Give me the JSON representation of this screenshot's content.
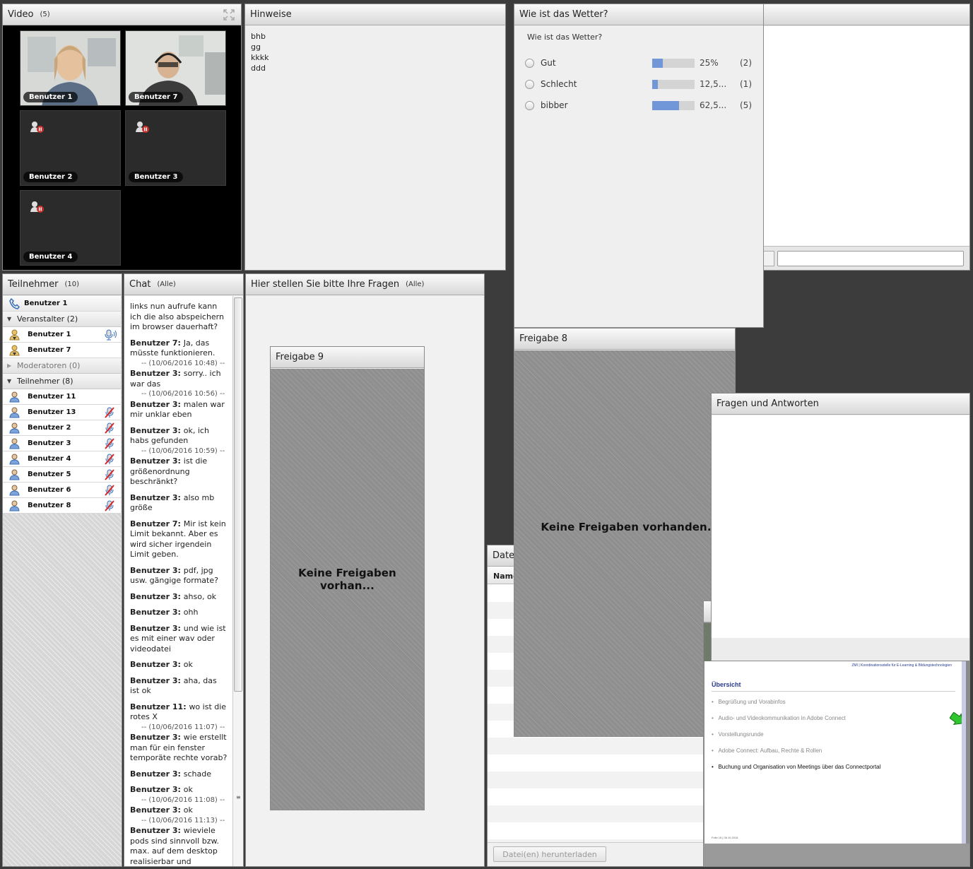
{
  "video": {
    "title": "Video",
    "count": "(5)",
    "tiles": [
      {
        "label": "Benutzer 1"
      },
      {
        "label": "Benutzer 7"
      },
      {
        "label": "Benutzer 2"
      },
      {
        "label": "Benutzer 3"
      },
      {
        "label": "Benutzer 4"
      }
    ]
  },
  "notes": {
    "title": "Hinweise",
    "lines": [
      "bhb",
      "gg",
      "kkkk",
      "ddd"
    ]
  },
  "poll": {
    "title": "Wie ist das Wetter?",
    "question": "Wie ist das Wetter?",
    "options": [
      {
        "label": "Gut",
        "percent_text": "25%",
        "count": "(2)",
        "fraction": 0.25
      },
      {
        "label": "Schlecht",
        "percent_text": "12,5...",
        "count": "(1)",
        "fraction": 0.125
      },
      {
        "label": "bibber",
        "percent_text": "62,5...",
        "count": "(5)",
        "fraction": 0.625
      }
    ]
  },
  "attendees": {
    "title": "Teilnehmer",
    "count": "(10)",
    "self": "Benutzer 1",
    "hosts_group": "Veranstalter (2)",
    "hosts": [
      "Benutzer 1",
      "Benutzer 7"
    ],
    "presenters_group": "Moderatoren (0)",
    "participants_group": "Teilnehmer (8)",
    "participants": [
      "Benutzer 11",
      "Benutzer 13",
      "Benutzer 2",
      "Benutzer 3",
      "Benutzer 4",
      "Benutzer 5",
      "Benutzer 6",
      "Benutzer 8"
    ]
  },
  "chat": {
    "title": "Chat",
    "scope": "(Alle)",
    "messages": [
      {
        "author": "",
        "text": "links nun aufrufe kann ich die also abspeichern im browser dauerhaft?",
        "ts": ""
      },
      {
        "author": "Benutzer 7",
        "text": "Ja, das müsste funktionieren.",
        "ts": "-- (10/06/2016 10:48) --"
      },
      {
        "author": "Benutzer 3",
        "text": "sorry.. ich war das",
        "ts": "-- (10/06/2016 10:56) --"
      },
      {
        "author": "Benutzer 3",
        "text": "malen war mir unklar eben",
        "ts": ""
      },
      {
        "author": "Benutzer 3",
        "text": "ok, ich habs gefunden",
        "ts": "-- (10/06/2016 10:59) --"
      },
      {
        "author": "Benutzer 3",
        "text": "ist die größenordnung beschränkt?",
        "ts": ""
      },
      {
        "author": "Benutzer 3",
        "text": "also mb größe",
        "ts": ""
      },
      {
        "author": "Benutzer 7",
        "text": "Mir ist kein Limit bekannt. Aber es wird sicher irgendein Limit geben.",
        "ts": ""
      },
      {
        "author": "Benutzer 3",
        "text": "pdf, jpg usw. gängige formate?",
        "ts": ""
      },
      {
        "author": "Benutzer 3",
        "text": "ahso, ok",
        "ts": ""
      },
      {
        "author": "Benutzer 3",
        "text": "ohh",
        "ts": ""
      },
      {
        "author": "Benutzer 3",
        "text": "und wie ist es mit einer wav oder videodatei",
        "ts": ""
      },
      {
        "author": "Benutzer 3",
        "text": "ok",
        "ts": ""
      },
      {
        "author": "Benutzer 3",
        "text": "aha, das ist ok",
        "ts": ""
      },
      {
        "author": "Benutzer 11",
        "text": "wo ist die rotes X",
        "ts": "-- (10/06/2016 11:07) --"
      },
      {
        "author": "Benutzer 3",
        "text": "wie erstellt man für ein fenster temporäte rechte vorab?",
        "ts": ""
      },
      {
        "author": "Benutzer 3",
        "text": "schade",
        "ts": ""
      },
      {
        "author": "Benutzer 3",
        "text": "ok",
        "ts": "-- (10/06/2016 11:08) --"
      },
      {
        "author": "Benutzer 3",
        "text": "ok",
        "ts": "-- (10/06/2016 11:13) --"
      },
      {
        "author": "Benutzer 3",
        "text": "wieviele pods sind sinnvoll bzw. max. auf dem desktop realisierbar und erkennbar",
        "ts": ""
      }
    ]
  },
  "questions": {
    "title": "Hier stellen Sie bitte Ihre Fragen",
    "scope": "(Alle)"
  },
  "share9": {
    "title": "Freigabe 9",
    "empty": "Keine Freigaben vorhan..."
  },
  "share8": {
    "title": "Freigabe 8",
    "empty": "Keine Freigaben vorhanden."
  },
  "files": {
    "title": "Date",
    "col_name": "Name",
    "download": "Datei(en) herunterladen"
  },
  "qa": {
    "title": "Fragen und Antworten"
  },
  "slide": {
    "header": "ZMI | Koordinationsstelle für E-Learning & Bildungstechnologien",
    "heading": "Übersicht",
    "items": [
      "Begrüßung und Vorabinfos",
      "Audio- und Videokommunikation in Adobe Connect",
      "Vorstellungsrunde",
      "Adobe Connect: Aufbau, Rechte & Rollen",
      "Buchung und Organisation von Meetings über das Connectportal"
    ],
    "footer": "Folie 15 | 06.10.2016"
  },
  "colors": {
    "accent": "#7197d8",
    "pod_bg": "#efefef",
    "stage_bg": "#3c3c3c"
  }
}
